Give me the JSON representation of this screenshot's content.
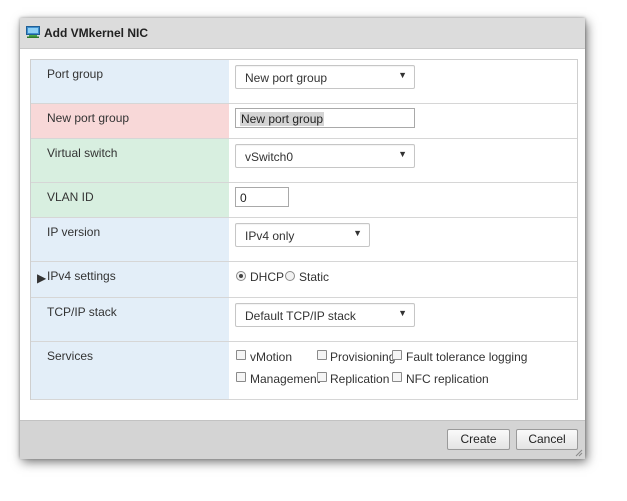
{
  "dialog": {
    "title": "Add VMkernel NIC",
    "icon": "vmkernel-nic-icon"
  },
  "form": {
    "port_group": {
      "label": "Port group",
      "value": "New port group"
    },
    "new_port_group": {
      "label": "New port group",
      "value": "New port group"
    },
    "virtual_switch": {
      "label": "Virtual switch",
      "value": "vSwitch0"
    },
    "vlan_id": {
      "label": "VLAN ID",
      "value": "0"
    },
    "ip_version": {
      "label": "IP version",
      "value": "IPv4 only"
    },
    "ipv4_settings": {
      "label": "IPv4 settings",
      "options": [
        "DHCP",
        "Static"
      ],
      "selected": "DHCP"
    },
    "tcpip_stack": {
      "label": "TCP/IP stack",
      "value": "Default TCP/IP stack"
    },
    "services": {
      "label": "Services",
      "items": [
        "vMotion",
        "Provisioning",
        "Fault tolerance logging",
        "Management",
        "Replication",
        "NFC replication"
      ]
    }
  },
  "footer": {
    "create_label": "Create",
    "cancel_label": "Cancel"
  },
  "colors": {
    "label_blue": "#e3eef8",
    "label_red": "#f8d8d8",
    "label_green": "#d8efe0",
    "titlebar": "#dcdcdc",
    "footer": "#d4d4d4"
  }
}
